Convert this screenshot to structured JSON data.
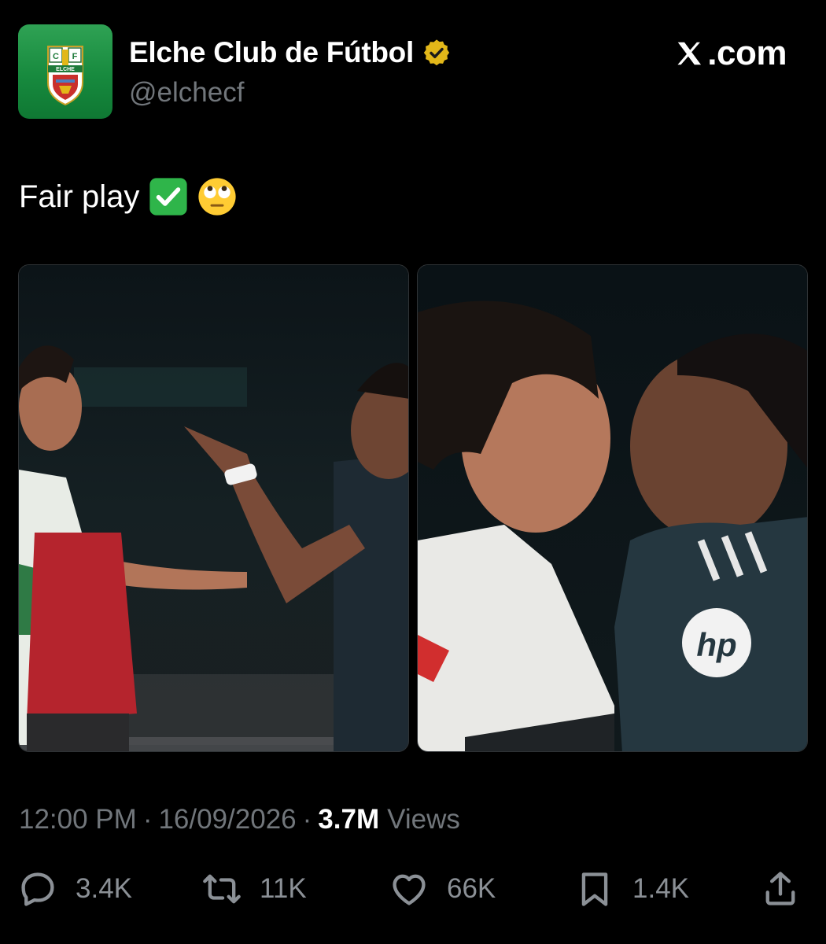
{
  "header": {
    "display_name": "Elche Club de Fútbol",
    "handle": "@elchecf",
    "avatar_text": {
      "top_left": "C",
      "top_right": "F",
      "band": "ELCHE"
    },
    "brand_text": ".com"
  },
  "tweet": {
    "text": "Fair play",
    "emojis": [
      "check-mark-button-emoji",
      "face-with-rolling-eyes-emoji"
    ]
  },
  "meta": {
    "time": "12:00 PM",
    "separator": "·",
    "date": "16/09/2026",
    "views_count": "3.7M",
    "views_label": "Views"
  },
  "actions": {
    "replies": "3.4K",
    "reposts": "11K",
    "likes": "66K",
    "bookmarks": "1.4K"
  },
  "colors": {
    "background": "#000000",
    "text_primary": "#ffffff",
    "text_secondary": "#71767b",
    "verified_badge": "#e2b719",
    "avatar_green": "#178a3e"
  },
  "icons": [
    "verified-badge-icon",
    "x-logo-icon",
    "reply-icon",
    "repost-icon",
    "like-icon",
    "bookmark-icon",
    "share-icon"
  ]
}
